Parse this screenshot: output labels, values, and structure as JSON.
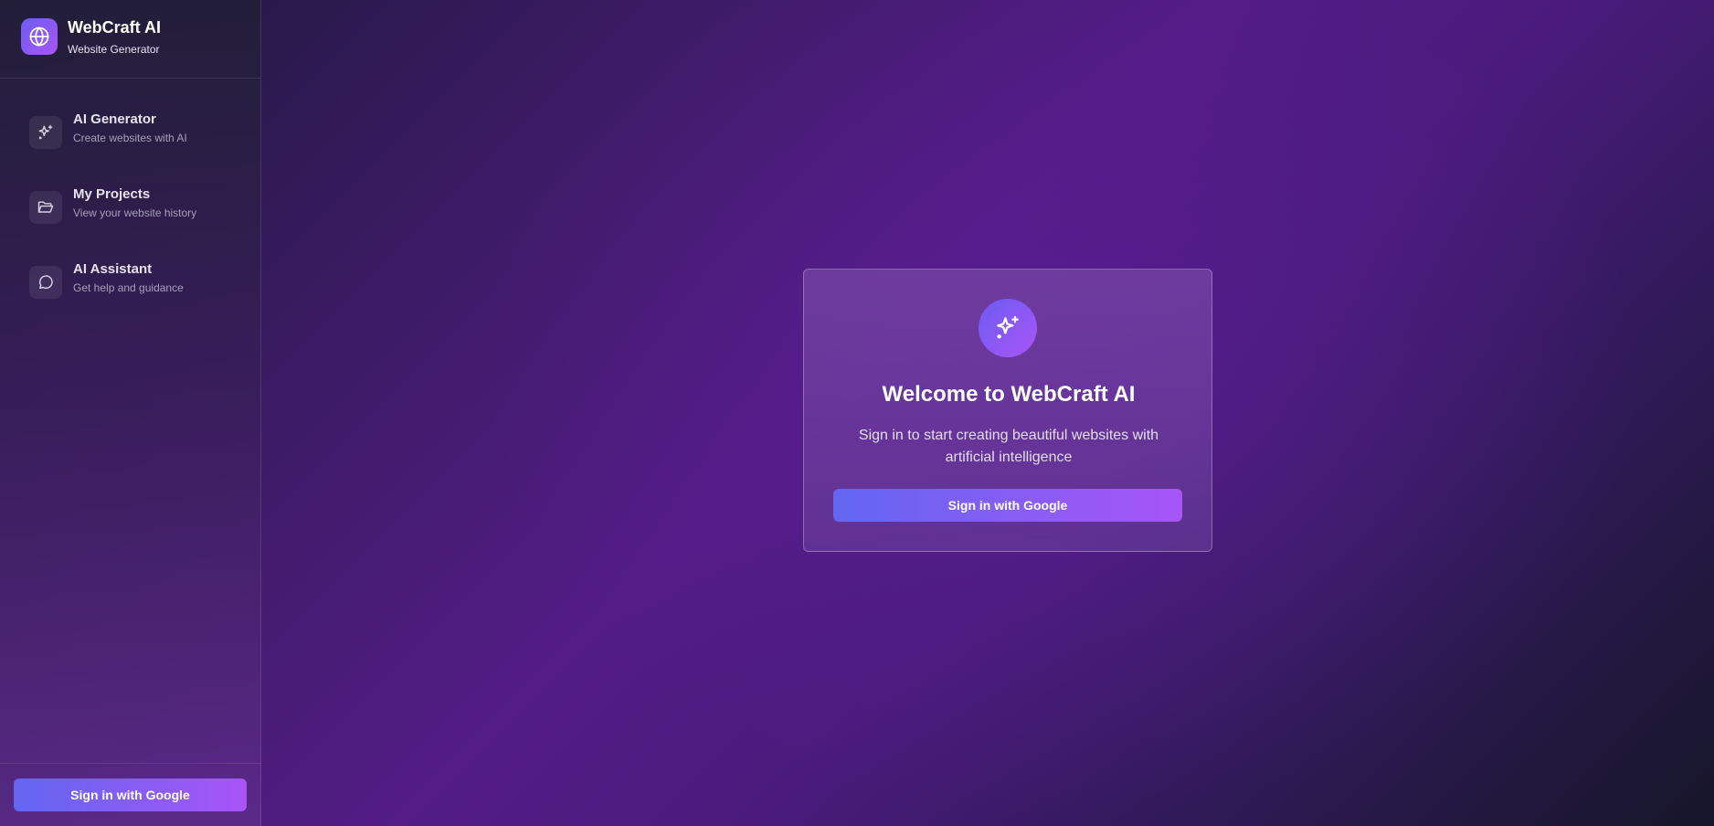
{
  "brand": {
    "title": "WebCraft AI",
    "subtitle": "Website Generator",
    "logo_icon": "globe-icon"
  },
  "sidebar": {
    "items": [
      {
        "label": "AI Generator",
        "description": "Create websites with AI",
        "icon": "sparkles-icon"
      },
      {
        "label": "My Projects",
        "description": "View your website history",
        "icon": "folder-open-icon"
      },
      {
        "label": "AI Assistant",
        "description": "Get help and guidance",
        "icon": "chat-bubble-icon"
      }
    ],
    "signin_label": "Sign in with Google"
  },
  "card": {
    "icon": "sparkles-icon",
    "title": "Welcome to WebCraft AI",
    "text": "Sign in to start creating beautiful websites with artificial intelligence",
    "signin_label": "Sign in with Google"
  },
  "colors": {
    "accent_start": "#6366f1",
    "accent_end": "#a855f7",
    "background": "#531c86"
  }
}
